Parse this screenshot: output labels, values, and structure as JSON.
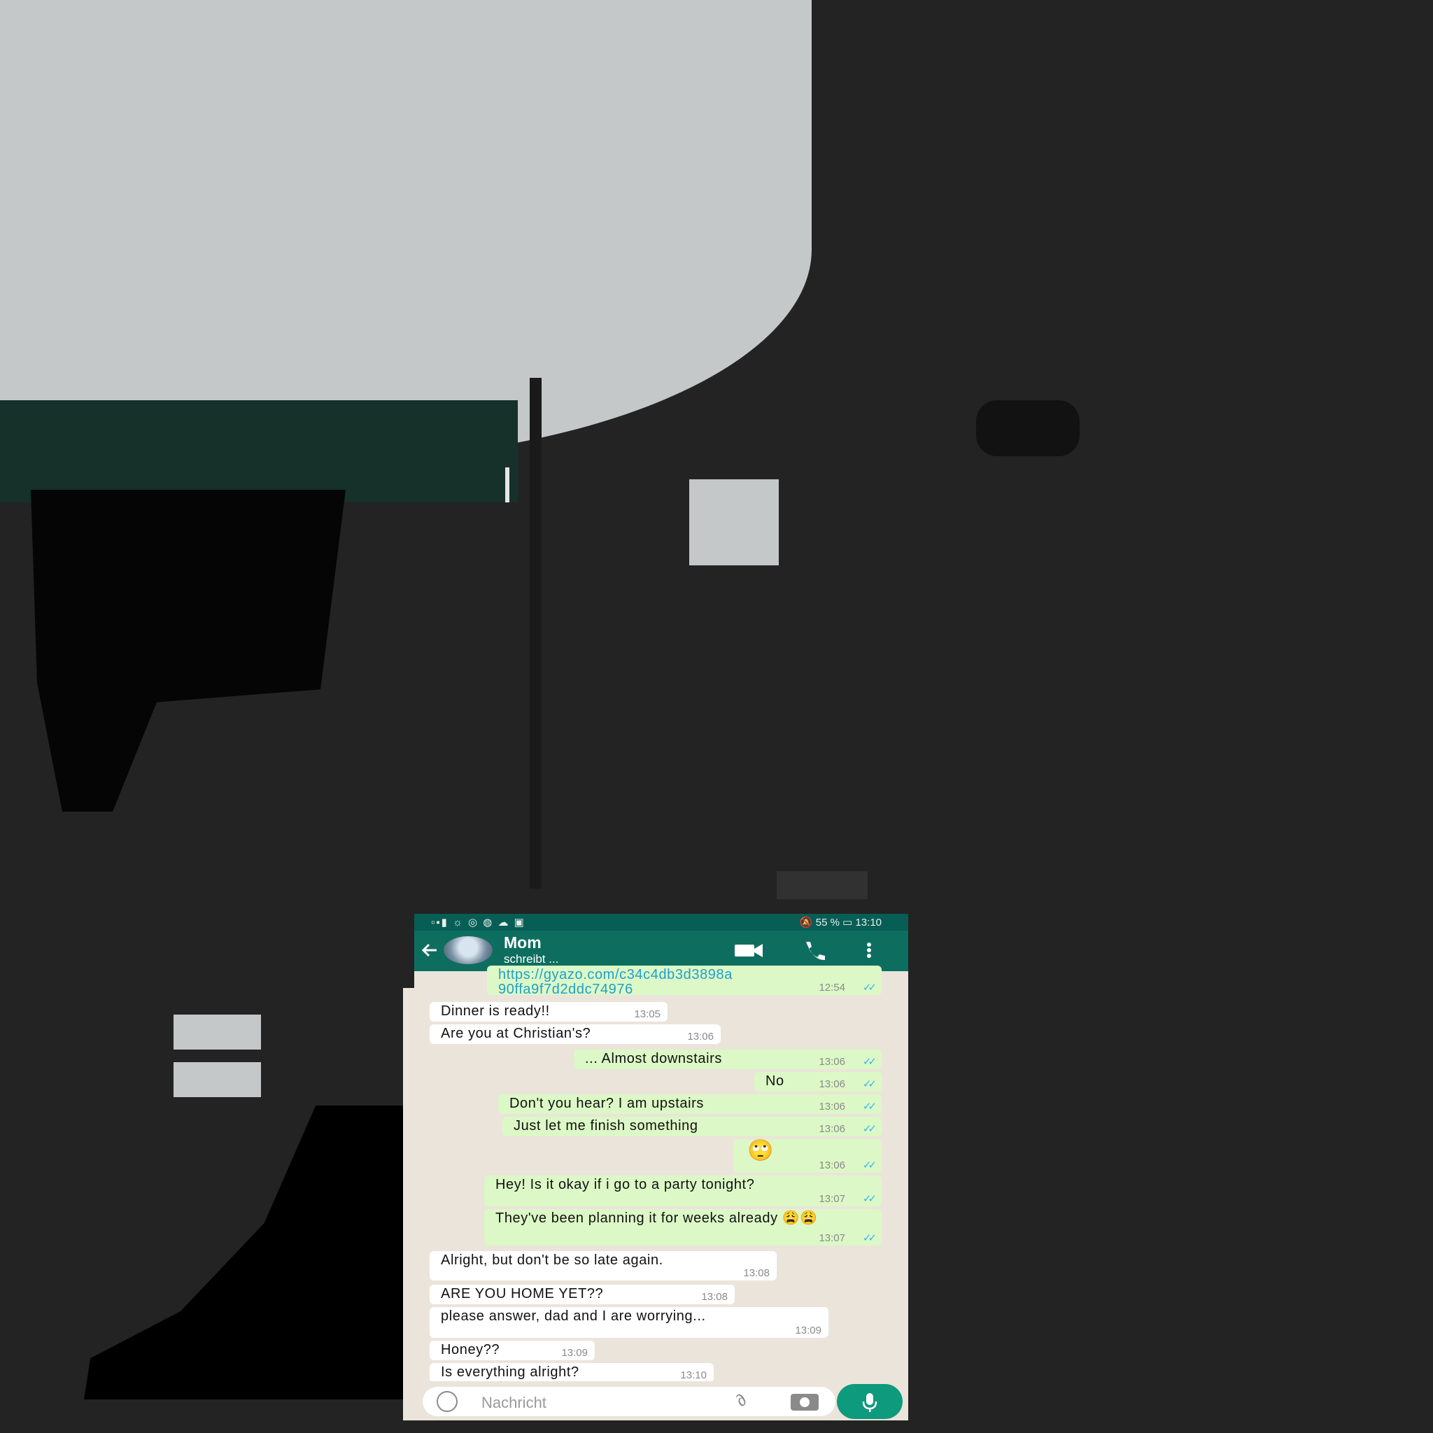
{
  "status_bar": {
    "left_icons": "▫▪▮ ☼ ◎ ◍ ☁ ▣",
    "right_text": "🔕 55 % ▭ 13:10"
  },
  "header": {
    "contact_name": "Mom",
    "contact_status": "schreibt ..."
  },
  "messages": [
    {
      "dir": "out",
      "text": "https://gyazo.com/c34c4db3d3898a 90ffa9f7d2ddc74976",
      "time": "12:54",
      "is_link": true
    },
    {
      "dir": "in",
      "text": "Dinner is ready!!",
      "time": "13:05"
    },
    {
      "dir": "in",
      "text": "Are you at Christian's?",
      "time": "13:06"
    },
    {
      "dir": "out",
      "text": "... Almost downstairs",
      "time": "13:06"
    },
    {
      "dir": "out",
      "text": "No",
      "time": "13:06"
    },
    {
      "dir": "out",
      "text": "Don't you hear? I am upstairs",
      "time": "13:06"
    },
    {
      "dir": "out",
      "text": "Just let me finish something",
      "time": "13:06"
    },
    {
      "dir": "out",
      "text": "🙄",
      "time": "13:06"
    },
    {
      "dir": "out",
      "text": "Hey! Is it okay if i go to a party tonight?",
      "time": "13:07"
    },
    {
      "dir": "out",
      "text": "They've been planning it for weeks already 😩😩",
      "time": "13:07"
    },
    {
      "dir": "in",
      "text": "Alright, but don't be so late again.",
      "time": "13:08"
    },
    {
      "dir": "in",
      "text": "ARE YOU HOME YET??",
      "time": "13:08"
    },
    {
      "dir": "in",
      "text": "please answer, dad and I are worrying...",
      "time": "13:09"
    },
    {
      "dir": "in",
      "text": "Honey??",
      "time": "13:09"
    },
    {
      "dir": "in",
      "text": "Is everything alright?",
      "time": "13:10"
    }
  ],
  "input": {
    "placeholder": "Nachricht"
  },
  "icons": {
    "back": "back-arrow-icon",
    "video": "video-call-icon",
    "call": "phone-call-icon",
    "menu": "more-vertical-icon",
    "emoji": "emoji-icon",
    "attach": "paperclip-icon",
    "camera": "camera-icon",
    "mic": "microphone-icon",
    "read": "double-check-icon"
  },
  "colors": {
    "header": "#0d6e60",
    "status_bar": "#075e54",
    "outgoing_bubble": "#dcf8c6",
    "incoming_bubble": "#ffffff",
    "chat_background": "#ebe4da",
    "mic_button": "#0e9a7d",
    "read_ticks": "#34b7f1"
  }
}
